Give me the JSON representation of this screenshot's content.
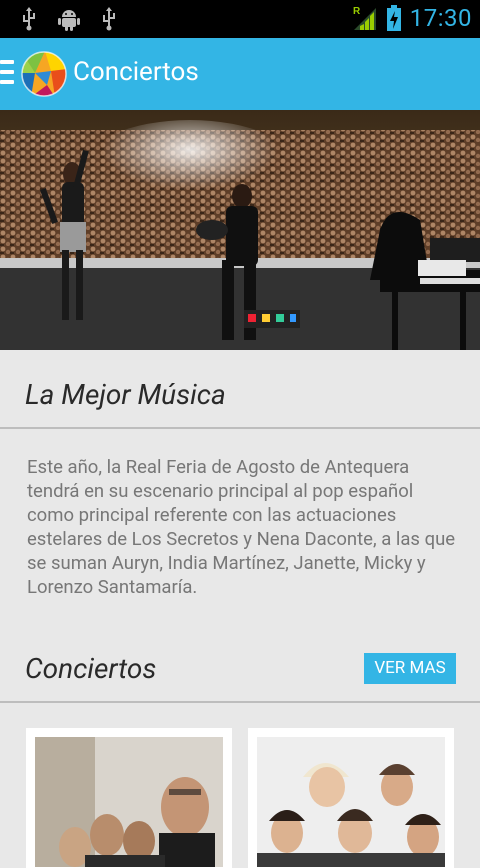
{
  "status_bar": {
    "time": "17:30",
    "roaming_indicator": "R",
    "icons": [
      "usb-icon",
      "android-debug-icon",
      "usb-icon",
      "signal-icon",
      "battery-charging-icon"
    ]
  },
  "action_bar": {
    "title": "Conciertos",
    "menu_icon": "hamburger-icon",
    "logo_icon": "app-logo"
  },
  "intro": {
    "heading": "La Mejor Música",
    "text": "Este año, la Real Feria de Agosto de Antequera tendrá en su escenario principal al pop español como principal referente con las actuaciones estelares de Los Secretos y Nena Daconte, a las que se suman Auryn, India Martínez, Janette, Micky y Lorenzo Santamaría."
  },
  "concerts": {
    "heading": "Conciertos",
    "more_button": "VER MAS"
  },
  "colors": {
    "accent": "#33b5e5",
    "background": "#e8e8e8"
  }
}
